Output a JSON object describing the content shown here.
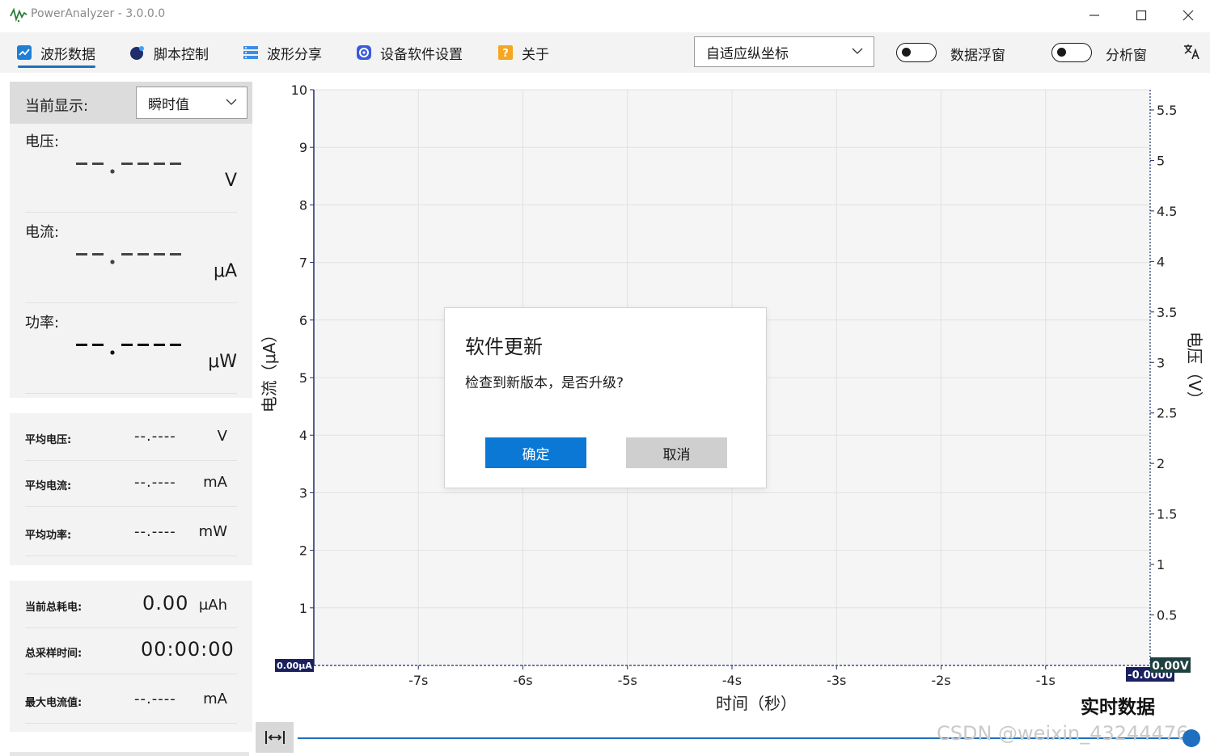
{
  "window": {
    "title": "PowerAnalyzer - 3.0.0.0"
  },
  "toolbar": {
    "tabs": [
      {
        "label": "波形数据",
        "icon": "waveform-icon"
      },
      {
        "label": "脚本控制",
        "icon": "script-icon"
      },
      {
        "label": "波形分享",
        "icon": "share-icon"
      },
      {
        "label": "设备软件设置",
        "icon": "gear-icon"
      },
      {
        "label": "关于",
        "icon": "help-icon"
      }
    ],
    "axis_mode": "自适应纵坐标",
    "toggle_float": {
      "label": "数据浮窗",
      "on": false
    },
    "toggle_analysis": {
      "label": "分析窗",
      "on": false
    }
  },
  "left": {
    "display_label": "当前显示:",
    "display_mode": "瞬时值",
    "voltage": {
      "label": "电压:",
      "unit": "V"
    },
    "current": {
      "label": "电流:",
      "unit": "μA"
    },
    "power": {
      "label": "功率:",
      "unit": "μW"
    },
    "avg": [
      {
        "label": "平均电压:",
        "value": "--.----",
        "unit": "V"
      },
      {
        "label": "平均电流:",
        "value": "--.----",
        "unit": "mA"
      },
      {
        "label": "平均功率:",
        "value": "--.----",
        "unit": "mW"
      }
    ],
    "totals": [
      {
        "label": "当前总耗电:",
        "value": "0.00",
        "unit": "μAh"
      },
      {
        "label": "总采样时间:",
        "value": "00:00:00",
        "unit": ""
      },
      {
        "label": "最大电流值:",
        "value": "--.----",
        "unit": "mA"
      }
    ]
  },
  "chart_data": {
    "type": "line",
    "xlabel": "时间（秒）",
    "ylabel": "电流（μA）",
    "y2label": "电压（V）",
    "x_ticks": [
      "-7s",
      "-6s",
      "-5s",
      "-4s",
      "-3s",
      "-2s",
      "-1s"
    ],
    "x_values": [
      -7,
      -6,
      -5,
      -4,
      -3,
      -2,
      -1
    ],
    "xlim": [
      -8,
      0
    ],
    "ylim": [
      0,
      10
    ],
    "y_ticks": [
      1,
      2,
      3,
      4,
      5,
      6,
      7,
      8,
      9,
      10
    ],
    "y2lim": [
      0,
      5.7
    ],
    "y2_ticks": [
      "0.5",
      "1",
      "1.5",
      "2",
      "2.5",
      "3",
      "3.5",
      "4",
      "4.5",
      "5",
      "5.5"
    ],
    "series": [],
    "grid": true,
    "current_marker": "0.00μA",
    "voltage_marker": "0.00V",
    "voltage_marker_low": "-0.0000",
    "status": "实时数据"
  },
  "dialog": {
    "title": "软件更新",
    "message": "检查到新版本，是否升级?",
    "ok_label": "确定",
    "cancel_label": "取消"
  },
  "watermark": "CSDN @weixin_43244476",
  "colors": {
    "accent": "#0a78d4",
    "axis": "#1f2d6b",
    "grid": "#e2e2e2",
    "plot_bg": "#f5f5f5"
  }
}
